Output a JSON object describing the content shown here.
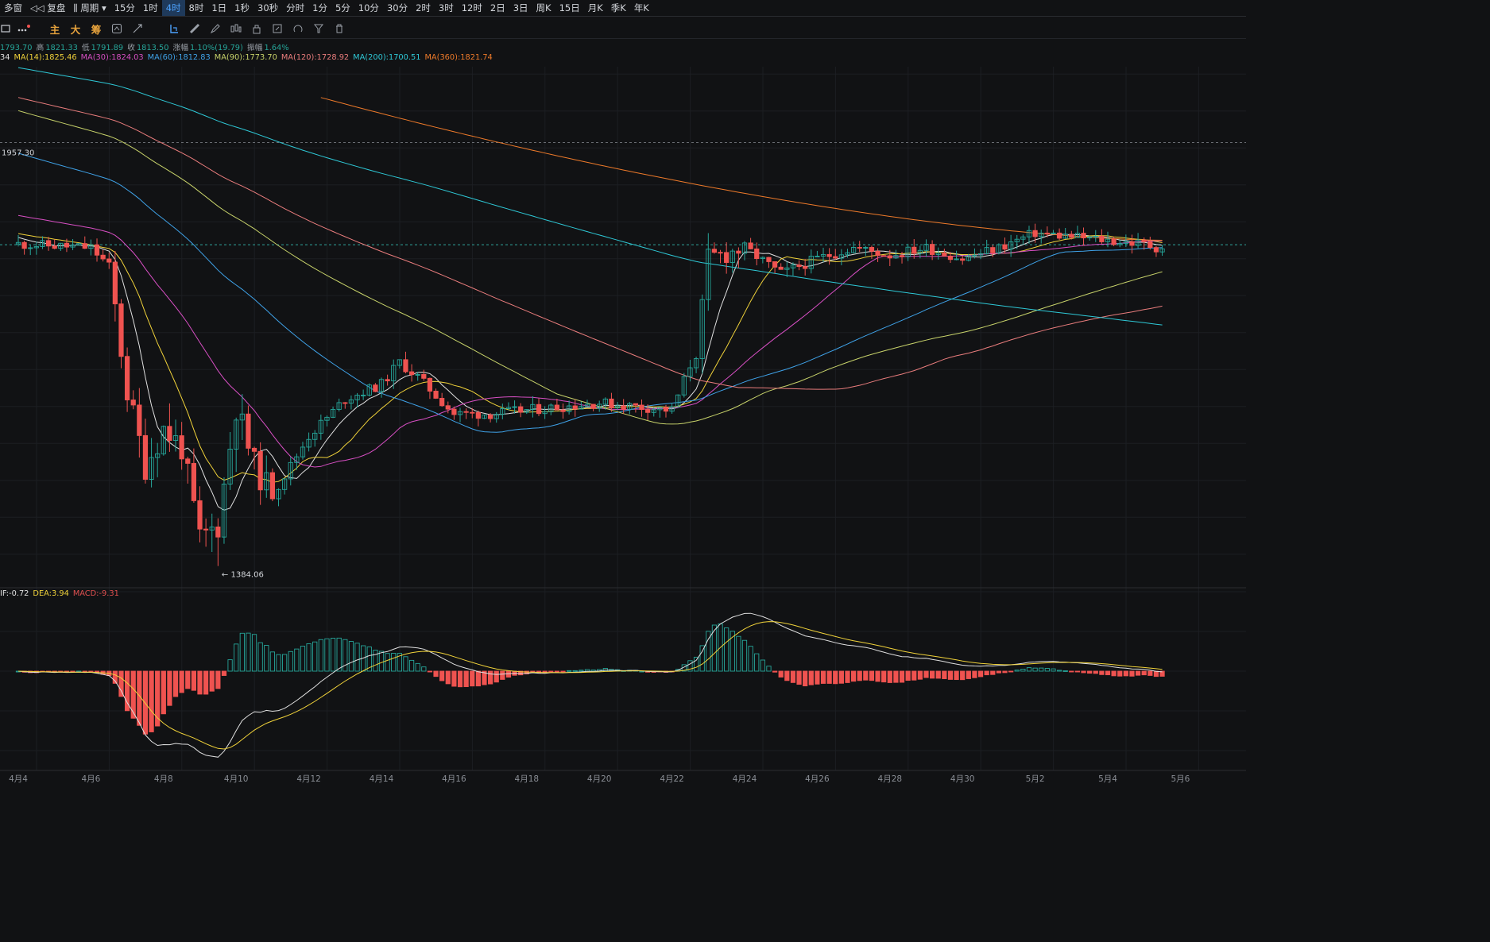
{
  "topbar": {
    "items": [
      "多窗",
      "复盘",
      "周期",
      "15分",
      "1时",
      "4时",
      "8时",
      "1日",
      "1秒",
      "30秒",
      "分时",
      "1分",
      "5分",
      "10分",
      "30分",
      "2时",
      "3时",
      "12时",
      "2日",
      "3日",
      "周K",
      "15日",
      "月K",
      "季K",
      "年K"
    ],
    "active_index": 5
  },
  "toolbar": {
    "main": "主",
    "big": "大",
    "chips": "筹"
  },
  "ohlc": {
    "open": "1793.70",
    "high_label": "高",
    "high": "1821.33",
    "low_label": "低",
    "low": "1791.89",
    "close_label": "收",
    "close": "1813.50",
    "change_label": "涨幅",
    "change": "1.10%(19.79)",
    "amp_label": "振幅",
    "amp": "1.64%"
  },
  "ma_legend": [
    {
      "label": "34",
      "color": "#e0e0e0"
    },
    {
      "label": "MA(14):1825.46",
      "color": "#f0d23a"
    },
    {
      "label": "MA(30):1824.03",
      "color": "#d84fc4"
    },
    {
      "label": "MA(60):1812.83",
      "color": "#3fa2e8"
    },
    {
      "label": "MA(90):1773.70",
      "color": "#c7d26a"
    },
    {
      "label": "MA(120):1728.92",
      "color": "#ea7d7d"
    },
    {
      "label": "MA(200):1700.51",
      "color": "#2ec8d6"
    },
    {
      "label": "MA(360):1821.74",
      "color": "#ee7a2a"
    }
  ],
  "macd_legend": [
    {
      "label": "IF:-0.72",
      "color": "#e0e0e0"
    },
    {
      "label": "DEA:3.94",
      "color": "#f0d23a"
    },
    {
      "label": "MACD:-9.31",
      "color": "#e04f4f"
    }
  ],
  "price_marks": {
    "high_mark": "1957.30",
    "low_mark": "← 1384.06"
  },
  "colors": {
    "up": "#26a69a",
    "down": "#ef5350",
    "bg": "#111214",
    "grid": "#1c1e22"
  },
  "chart_data": {
    "type": "candlestick",
    "x_tick_labels": [
      "4月4",
      "4月6",
      "4月8",
      "4月10",
      "4月12",
      "4月14",
      "4月16",
      "4月18",
      "4月20",
      "4月22",
      "4月24",
      "4月26",
      "4月28",
      "4月30",
      "5月2",
      "5月4",
      "5月6"
    ],
    "price_range": [
      1360,
      2060
    ],
    "reference_lines": [
      1957.3,
      1819
    ],
    "last_close": 1813.5,
    "period_low": 1384.06,
    "ohlc_keypoints": [
      [
        "4月4",
        1820
      ],
      [
        "4月6",
        1815
      ],
      [
        "4月6.5",
        1790
      ],
      [
        "4月7",
        1620
      ],
      [
        "4月7.5",
        1520
      ],
      [
        "4月8",
        1570
      ],
      [
        "4月8.5",
        1545
      ],
      [
        "4月9",
        1420
      ],
      [
        "4月9.5",
        1440
      ],
      [
        "4月10",
        1600
      ],
      [
        "4月10.5",
        1520
      ],
      [
        "4月11",
        1480
      ],
      [
        "4月12",
        1560
      ],
      [
        "4月13",
        1610
      ],
      [
        "4月14",
        1630
      ],
      [
        "4月14.5",
        1660
      ],
      [
        "4月15",
        1640
      ],
      [
        "4月16",
        1590
      ],
      [
        "4月17",
        1590
      ],
      [
        "4月18",
        1595
      ],
      [
        "4月19",
        1600
      ],
      [
        "4月20",
        1605
      ],
      [
        "4月21",
        1600
      ],
      [
        "4月22",
        1595
      ],
      [
        "4月22.7",
        1680
      ],
      [
        "4月23",
        1800
      ],
      [
        "4月24",
        1815
      ],
      [
        "4月25",
        1780
      ],
      [
        "4月26",
        1800
      ],
      [
        "4月27",
        1815
      ],
      [
        "4月28",
        1805
      ],
      [
        "4月29",
        1815
      ],
      [
        "4月30",
        1800
      ],
      [
        "5月1",
        1815
      ],
      [
        "5月2",
        1835
      ],
      [
        "5月3",
        1830
      ],
      [
        "5月4",
        1825
      ],
      [
        "5月5",
        1820
      ],
      [
        "5月5.5",
        1813
      ]
    ],
    "ma": [
      {
        "name": "MA(14)",
        "value": 1825.46
      },
      {
        "name": "MA(30)",
        "value": 1824.03
      },
      {
        "name": "MA(60)",
        "value": 1812.83
      },
      {
        "name": "MA(90)",
        "value": 1773.7
      },
      {
        "name": "MA(120)",
        "value": 1728.92
      },
      {
        "name": "MA(200)",
        "value": 1700.51
      },
      {
        "name": "MA(360)",
        "value": 1821.74
      }
    ],
    "macd": {
      "dif": -0.72,
      "dea": 3.94,
      "macd": -9.31,
      "range": [
        -100,
        80
      ]
    }
  }
}
